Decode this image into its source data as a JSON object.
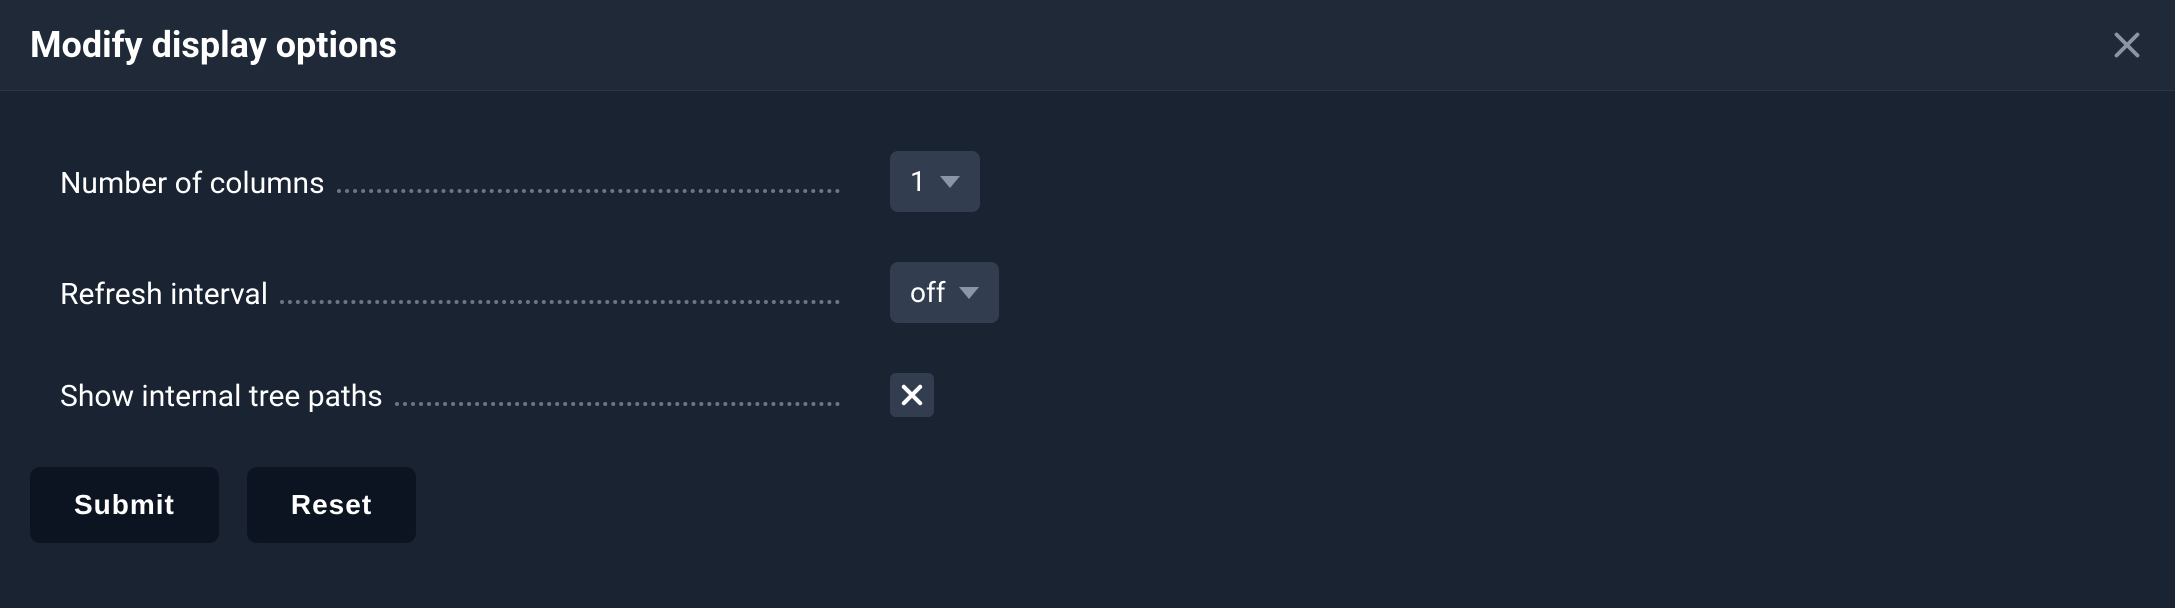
{
  "header": {
    "title": "Modify display options"
  },
  "form": {
    "columns": {
      "label": "Number of columns",
      "value": "1"
    },
    "refresh": {
      "label": "Refresh interval",
      "value": "off"
    },
    "treePaths": {
      "label": "Show internal tree paths"
    }
  },
  "buttons": {
    "submit": "Submit",
    "reset": "Reset"
  }
}
